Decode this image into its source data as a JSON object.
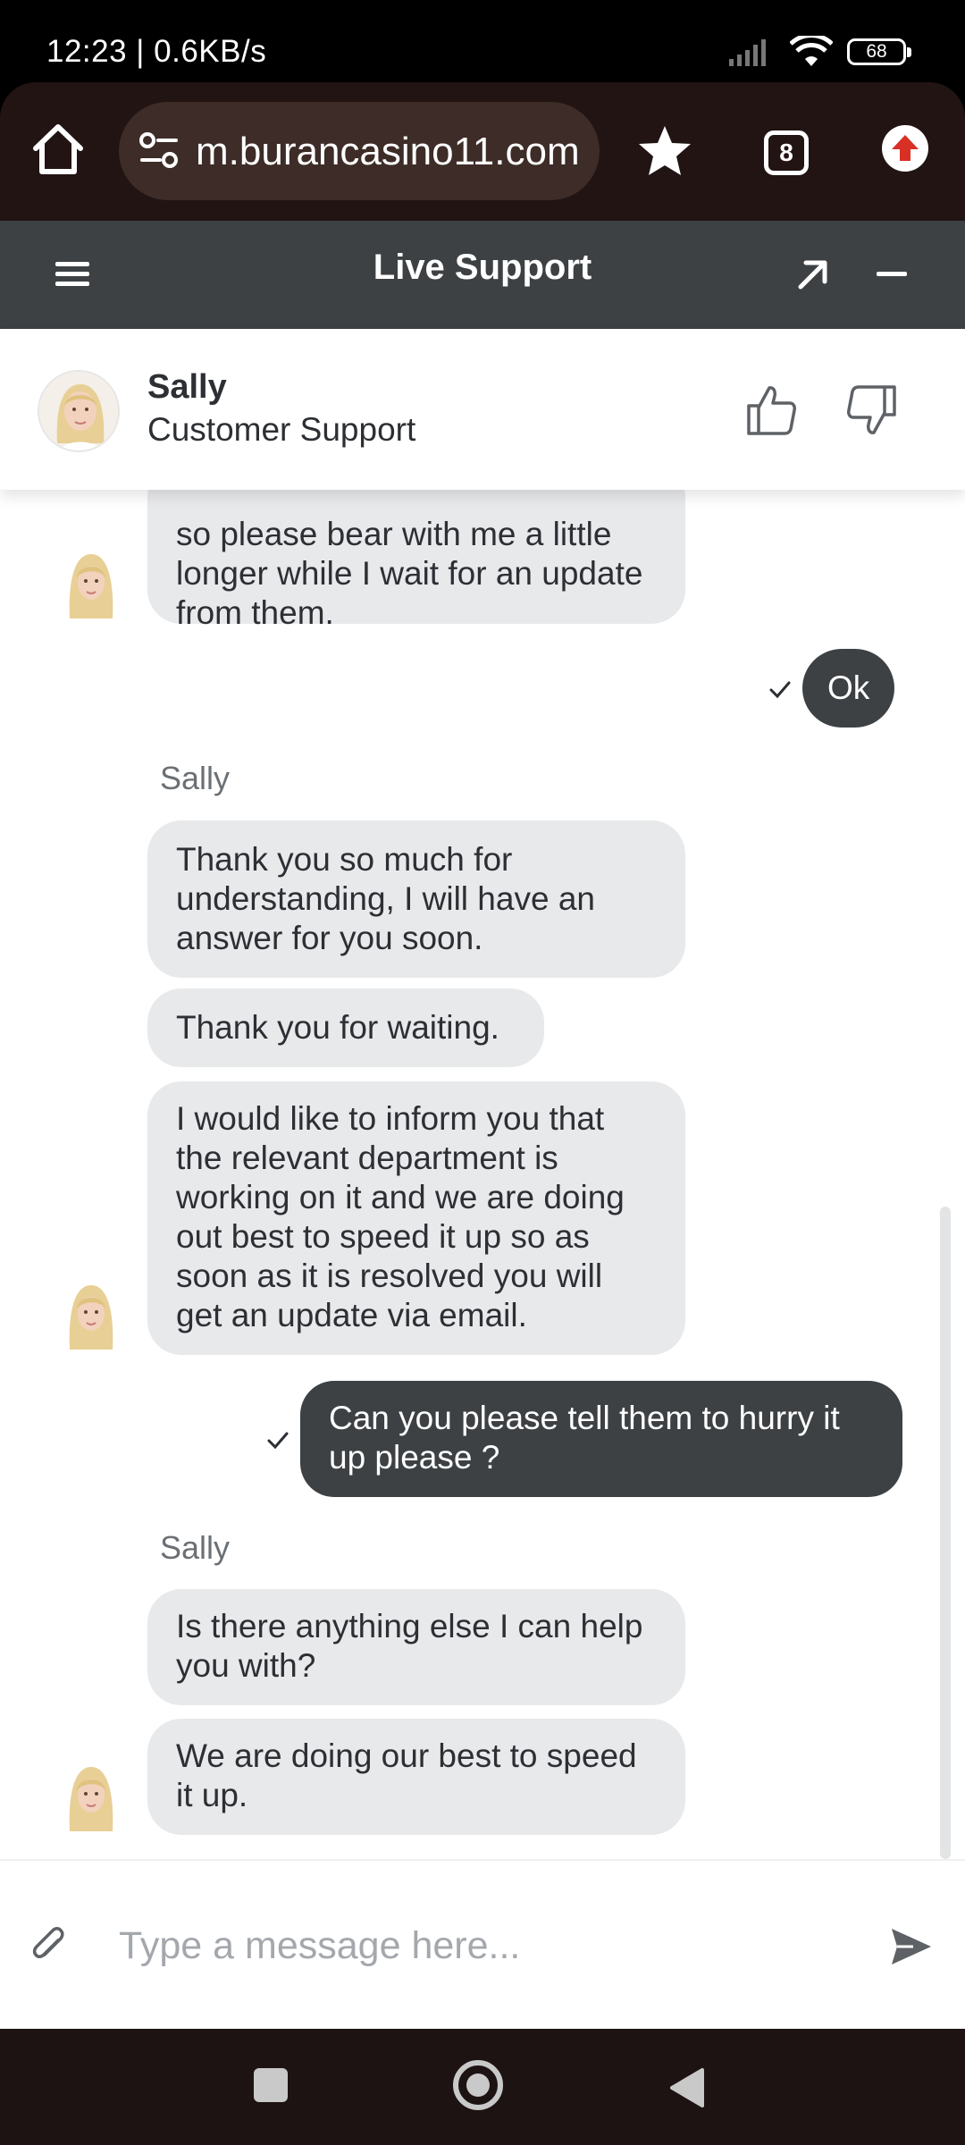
{
  "status_bar": {
    "time": "12:23 | 0.6KB/s",
    "battery": "68"
  },
  "browser": {
    "url": "m.burancasino11.com",
    "tab_count": "8"
  },
  "support_header": {
    "title": "Live Support"
  },
  "agent": {
    "name": "Sally",
    "role": "Customer Support"
  },
  "messages": [
    {
      "from": "agent",
      "text": "so please bear with me a little longer while I wait for an update from them."
    },
    {
      "from": "user",
      "text": "Ok"
    },
    {
      "from": "agent_label",
      "text": "Sally"
    },
    {
      "from": "agent",
      "text": "Thank you so much for understanding, I will have an answer for you soon."
    },
    {
      "from": "agent",
      "text": "Thank you for waiting."
    },
    {
      "from": "agent",
      "text": "I would like to inform you that the relevant department is working on it and we are doing out best to speed it up so as soon as it is resolved you will get an update via email."
    },
    {
      "from": "user",
      "text": "Can you please tell them to hurry it up please ?"
    },
    {
      "from": "agent_label",
      "text": "Sally"
    },
    {
      "from": "agent",
      "text": "Is there anything else I can help you with?"
    },
    {
      "from": "agent",
      "text": "We are doing our best to speed it up."
    }
  ],
  "composer": {
    "placeholder": "Type a message here..."
  },
  "colors": {
    "header_bg": "#3d4144",
    "agent_bubble": "#e8e9eb",
    "user_bubble": "#3d4144",
    "browser_bg": "#211413"
  }
}
